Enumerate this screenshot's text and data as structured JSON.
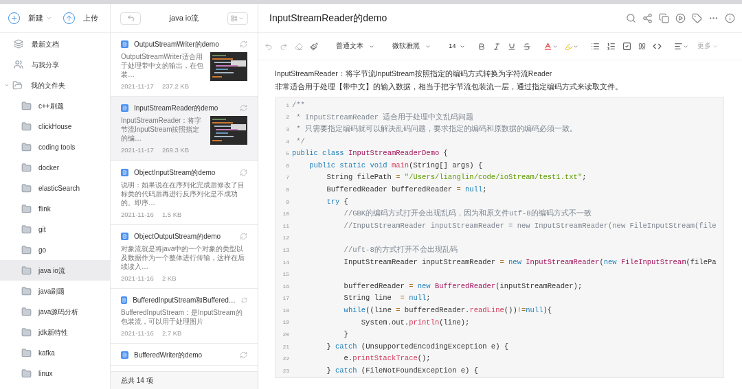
{
  "sidebar": {
    "actions": [
      {
        "kind": "new",
        "label": "新建"
      },
      {
        "kind": "upload",
        "label": "上传"
      }
    ],
    "items": [
      {
        "kind": "recent",
        "label": "最新文档",
        "selected": false
      },
      {
        "kind": "shared",
        "label": "与我分享",
        "selected": false
      },
      {
        "kind": "folder",
        "label": "我的文件夹",
        "selected": false,
        "expanded": true,
        "children": [
          {
            "label": "c++刷题",
            "selected": false
          },
          {
            "label": "clickHouse",
            "selected": false
          },
          {
            "label": "coding tools",
            "selected": false
          },
          {
            "label": "docker",
            "selected": false
          },
          {
            "label": "elasticSearch",
            "selected": false
          },
          {
            "label": "flink",
            "selected": false
          },
          {
            "label": "git",
            "selected": false
          },
          {
            "label": "go",
            "selected": false
          },
          {
            "label": "java io流",
            "selected": true
          },
          {
            "label": "java刷题",
            "selected": false
          },
          {
            "label": "java源码分析",
            "selected": false
          },
          {
            "label": "jdk新特性",
            "selected": false
          },
          {
            "label": "kafka",
            "selected": false
          },
          {
            "label": "linux",
            "selected": false
          }
        ]
      }
    ]
  },
  "doc_list": {
    "title": "java io流",
    "footer": "总共 14 项",
    "items": [
      {
        "kind": "with_picture",
        "title": "OutputStreamWriter的demo",
        "summary": "OutputStreamWriter适合用于处理带中文的输出，在包装…",
        "date": "2021-11-17",
        "size": "237.2 KB",
        "selected": false
      },
      {
        "kind": "with_picture",
        "title": "InputStreamReader的demo",
        "summary": "InputStreamReader：将字节流InputStream按照指定的编…",
        "date": "2021-11-17",
        "size": "269.3 KB",
        "selected": true
      },
      {
        "kind": "text",
        "title": "ObjectInputStream的demo",
        "summary": "说明：如果说在在序列化完成后修改了目标类的代码后再进行反序列化是不成功的。即序…",
        "date": "2021-11-16",
        "size": "1.5 KB",
        "selected": false
      },
      {
        "kind": "text",
        "title": "ObjectOutputStream的demo",
        "summary": "对象流就是将java中的一个对象的类型以及数据作为一个整体进行传输，这样在后续读入…",
        "date": "2021-11-16",
        "size": "2 KB",
        "selected": false
      },
      {
        "kind": "text",
        "title": "BufferedInputStream和Buffered…",
        "summary": "BufferedInputStream：是InputStream的包装流，可以用于处理图片",
        "date": "2021-11-16",
        "size": "2.7 KB",
        "selected": false
      },
      {
        "kind": "title_only",
        "title": "BufferedWriter的demo",
        "selected": false
      }
    ]
  },
  "editor": {
    "title": "InputStreamReader的demo",
    "toolbar": {
      "paragraph_style": "普通文本",
      "font": "微软雅黑",
      "font_size": "14",
      "more": "更多"
    },
    "paragraphs": [
      "InputStreamReader：将字节流InputStream按照指定的编码方式转换为字符流Reader",
      "非常适合用于处理【带中文】的输入数据，相当于把字节流包装流一层，通过指定编码方式来读取文件。"
    ],
    "code_lines": [
      {
        "number": "1",
        "tokens": [
          {
            "kind": "comment",
            "text": "/**"
          }
        ]
      },
      {
        "number": "2",
        "tokens": [
          {
            "kind": "comment",
            "text": " * InputStreamReader 适合用于处理中文乱码问题"
          }
        ]
      },
      {
        "number": "3",
        "tokens": [
          {
            "kind": "comment",
            "text": " * 只需要指定编码就可以解决乱码问题，要求指定的编码和原数据的编码必须一致。"
          }
        ]
      },
      {
        "number": "4",
        "tokens": [
          {
            "kind": "comment",
            "text": " */"
          }
        ]
      },
      {
        "number": "5",
        "tokens": [
          {
            "kind": "keyword",
            "text": "public class "
          },
          {
            "kind": "class",
            "text": "InputStreamReaderDemo"
          },
          {
            "kind": "plain",
            "text": " {"
          }
        ]
      },
      {
        "number": "6",
        "tokens": [
          {
            "kind": "keyword",
            "text": "    public static void "
          },
          {
            "kind": "method",
            "text": "main"
          },
          {
            "kind": "plain",
            "text": "(String[] args) {"
          }
        ]
      },
      {
        "number": "7",
        "tokens": [
          {
            "kind": "plain",
            "text": "        String filePath "
          },
          {
            "kind": "operator",
            "text": "="
          },
          {
            "kind": "string",
            "text": " \"/Users/lianglin/code/ioStream/test1.txt\""
          },
          {
            "kind": "plain",
            "text": ";"
          }
        ]
      },
      {
        "number": "8",
        "tokens": [
          {
            "kind": "plain",
            "text": "        BufferedReader bufferedReader "
          },
          {
            "kind": "operator",
            "text": "="
          },
          {
            "kind": "keyword",
            "text": " null"
          },
          {
            "kind": "plain",
            "text": ";"
          }
        ]
      },
      {
        "number": "9",
        "tokens": [
          {
            "kind": "keyword",
            "text": "        try"
          },
          {
            "kind": "plain",
            "text": " {"
          }
        ]
      },
      {
        "number": "10",
        "tokens": [
          {
            "kind": "comment",
            "text": "            //GBK的编码方式打开会出现乱码，因为和原文件utf-8的编码方式不一致"
          }
        ]
      },
      {
        "number": "11",
        "tokens": [
          {
            "kind": "comment",
            "text": "            //InputStreamReader inputStreamReader = new InputStreamReader(new FileInputStream(file"
          }
        ]
      },
      {
        "number": "12"
      },
      {
        "number": "13",
        "tokens": [
          {
            "kind": "comment",
            "text": "            //uft-8的方式打开不会出现乱码"
          }
        ]
      },
      {
        "number": "14",
        "tokens": [
          {
            "kind": "plain",
            "text": "            InputStreamReader inputStreamReader "
          },
          {
            "kind": "operator",
            "text": "="
          },
          {
            "kind": "keyword",
            "text": " new "
          },
          {
            "kind": "class",
            "text": "InputStreamReader"
          },
          {
            "kind": "plain",
            "text": "("
          },
          {
            "kind": "keyword",
            "text": "new "
          },
          {
            "kind": "class",
            "text": "FileInputStream"
          },
          {
            "kind": "plain",
            "text": "(filePa"
          }
        ]
      },
      {
        "number": "15"
      },
      {
        "number": "16",
        "tokens": [
          {
            "kind": "plain",
            "text": "            bufferedReader "
          },
          {
            "kind": "operator",
            "text": "="
          },
          {
            "kind": "keyword",
            "text": " new "
          },
          {
            "kind": "class",
            "text": "BufferedReader"
          },
          {
            "kind": "plain",
            "text": "(inputStreamReader);"
          }
        ]
      },
      {
        "number": "17",
        "tokens": [
          {
            "kind": "plain",
            "text": "            String line  "
          },
          {
            "kind": "operator",
            "text": "="
          },
          {
            "kind": "keyword",
            "text": " null"
          },
          {
            "kind": "plain",
            "text": ";"
          }
        ]
      },
      {
        "number": "18",
        "tokens": [
          {
            "kind": "keyword",
            "text": "            while"
          },
          {
            "kind": "plain",
            "text": "((line "
          },
          {
            "kind": "operator",
            "text": "="
          },
          {
            "kind": "plain",
            "text": " bufferedReader."
          },
          {
            "kind": "method",
            "text": "readLine"
          },
          {
            "kind": "plain",
            "text": "())"
          },
          {
            "kind": "operator",
            "text": "!="
          },
          {
            "kind": "keyword",
            "text": "null"
          },
          {
            "kind": "plain",
            "text": "){"
          }
        ]
      },
      {
        "number": "19",
        "tokens": [
          {
            "kind": "plain",
            "text": "                System.out."
          },
          {
            "kind": "method",
            "text": "println"
          },
          {
            "kind": "plain",
            "text": "(line);"
          }
        ]
      },
      {
        "number": "20",
        "tokens": [
          {
            "kind": "plain",
            "text": "            }"
          }
        ]
      },
      {
        "number": "21",
        "tokens": [
          {
            "kind": "plain",
            "text": "        } "
          },
          {
            "kind": "keyword",
            "text": "catch"
          },
          {
            "kind": "plain",
            "text": " (UnsupportedEncodingException e) {"
          }
        ]
      },
      {
        "number": "22",
        "tokens": [
          {
            "kind": "plain",
            "text": "            e."
          },
          {
            "kind": "method",
            "text": "printStackTrace"
          },
          {
            "kind": "plain",
            "text": "();"
          }
        ]
      },
      {
        "number": "23",
        "tokens": [
          {
            "kind": "plain",
            "text": "        } "
          },
          {
            "kind": "keyword",
            "text": "catch"
          },
          {
            "kind": "plain",
            "text": " (FileNotFoundException e) {"
          }
        ]
      }
    ]
  }
}
